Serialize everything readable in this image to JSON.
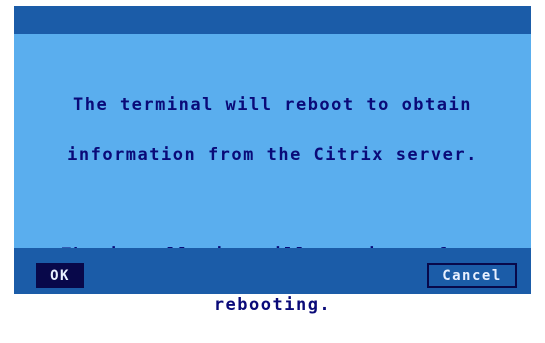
{
  "dialog": {
    "message_line1": "The terminal will reboot to obtain",
    "message_line2": "information from the Citrix server.",
    "message_line3": "The installation will continue after",
    "message_line4": "rebooting.",
    "ok_label": "OK",
    "cancel_label": "Cancel"
  },
  "colors": {
    "frame": "#1b5ca8",
    "content_background": "#5aaeee",
    "text": "#0a0a78",
    "ok_button_background": "#08084a"
  }
}
